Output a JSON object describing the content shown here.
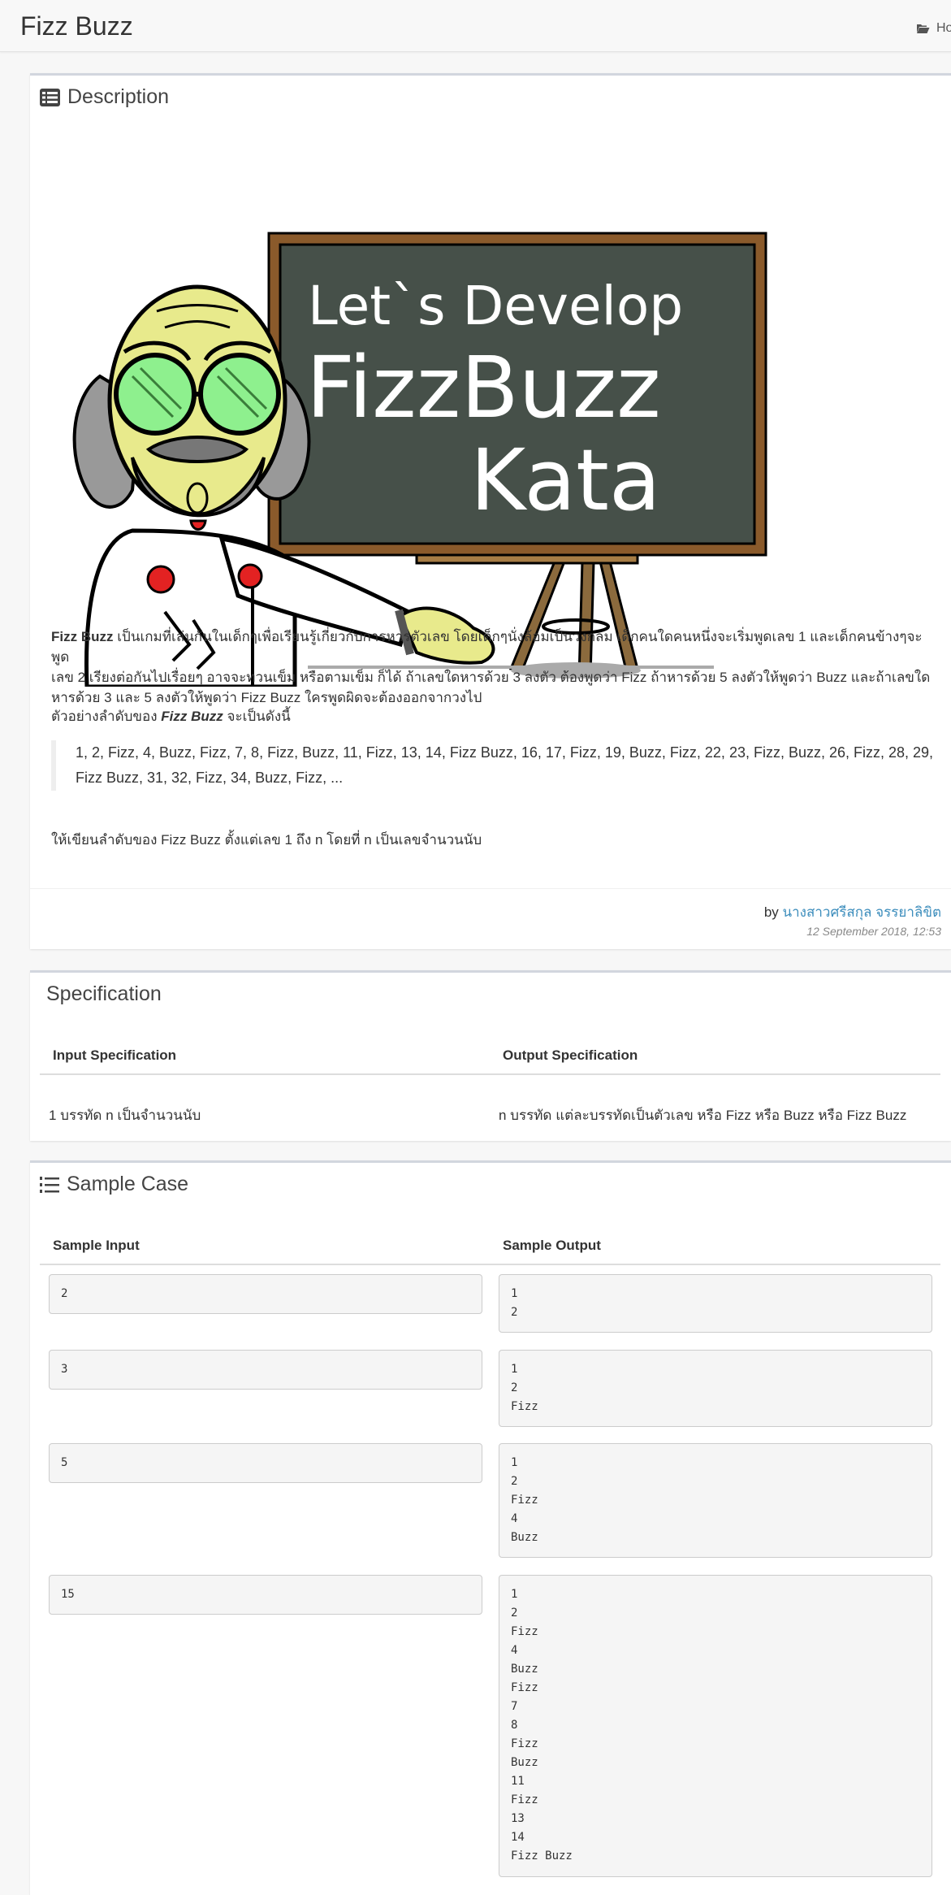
{
  "header": {
    "title": "Fizz Buzz",
    "home_label": "Ho"
  },
  "description": {
    "heading": "Description",
    "banner": {
      "line1": "Let`s Develop",
      "line2": "FizzBuzz",
      "line3": "Kata"
    },
    "intro_bold": "Fizz Buzz",
    "intro_line1": " เป็นเกมที่เล่นกันในเด็กๆเพื่อเรียนรู้เกี่ยวกับการหารตัวเลข โดยเด็กๆนั่งล้อมเป็นวงกลม เด็กคนใดคนหนึ่งจะเริ่มพูดเลข 1 และเด็กคนข้างๆจะพูด",
    "intro_line2": "เลข 2 เรียงต่อกันไปเรื่อยๆ อาจจะทวนเข็ม หรือตามเข็ม ก็ได้ ถ้าเลขใดหารด้วย 3 ลงตัว ต้องพูดว่า Fizz ถ้าหารด้วย 5 ลงตัวให้พูดว่า Buzz และถ้าเลขใด",
    "intro_line3": "หารด้วย 3 และ 5 ลงตัวให้พูดว่า Fizz Buzz ใครพูดผิดจะต้องออกจากวงไป",
    "example_prefix": "ตัวอย่างลำดับของ ",
    "example_em": "Fizz Buzz",
    "example_suffix": " จะเป็นดังนี้",
    "sequence_line1": "1, 2, Fizz, 4, Buzz, Fizz, 7, 8, Fizz, Buzz, 11, Fizz, 13, 14, Fizz Buzz, 16, 17, Fizz, 19, Buzz, Fizz, 22, 23, Fizz, Buzz, 26, Fizz, 28, 29,",
    "sequence_line2": "Fizz Buzz, 31, 32, Fizz, 34, Buzz, Fizz, ...",
    "task": "ให้เขียนลำดับของ Fizz Buzz ตั้งแต่เลข 1 ถึง n โดยที่ n เป็นเลขจำนวนนับ",
    "by_label": "by ",
    "author": "นางสาวศรีสกุล จรรยาลิขิต",
    "date": "12 September 2018, 12:53"
  },
  "specification": {
    "heading": "Specification",
    "input_header": "Input Specification",
    "output_header": "Output Specification",
    "input_text": "1 บรรทัด n เป็นจำนวนนับ",
    "output_text": "n บรรทัด แต่ละบรรทัดเป็นตัวเลข หรือ Fizz หรือ Buzz หรือ Fizz Buzz"
  },
  "samples": {
    "heading": "Sample Case",
    "input_header": "Sample Input",
    "output_header": "Sample Output",
    "cases": [
      {
        "input": "2",
        "output": "1\n2"
      },
      {
        "input": "3",
        "output": "1\n2\nFizz"
      },
      {
        "input": "5",
        "output": "1\n2\nFizz\n4\nBuzz"
      },
      {
        "input": "15",
        "output": "1\n2\nFizz\n4\nBuzz\nFizz\n7\n8\nFizz\nBuzz\n11\nFizz\n13\n14\nFizz Buzz"
      }
    ]
  },
  "colors": {
    "link": "#3c8dbc",
    "chalkboard": "#465049",
    "board_frame": "#8a5a2b"
  }
}
